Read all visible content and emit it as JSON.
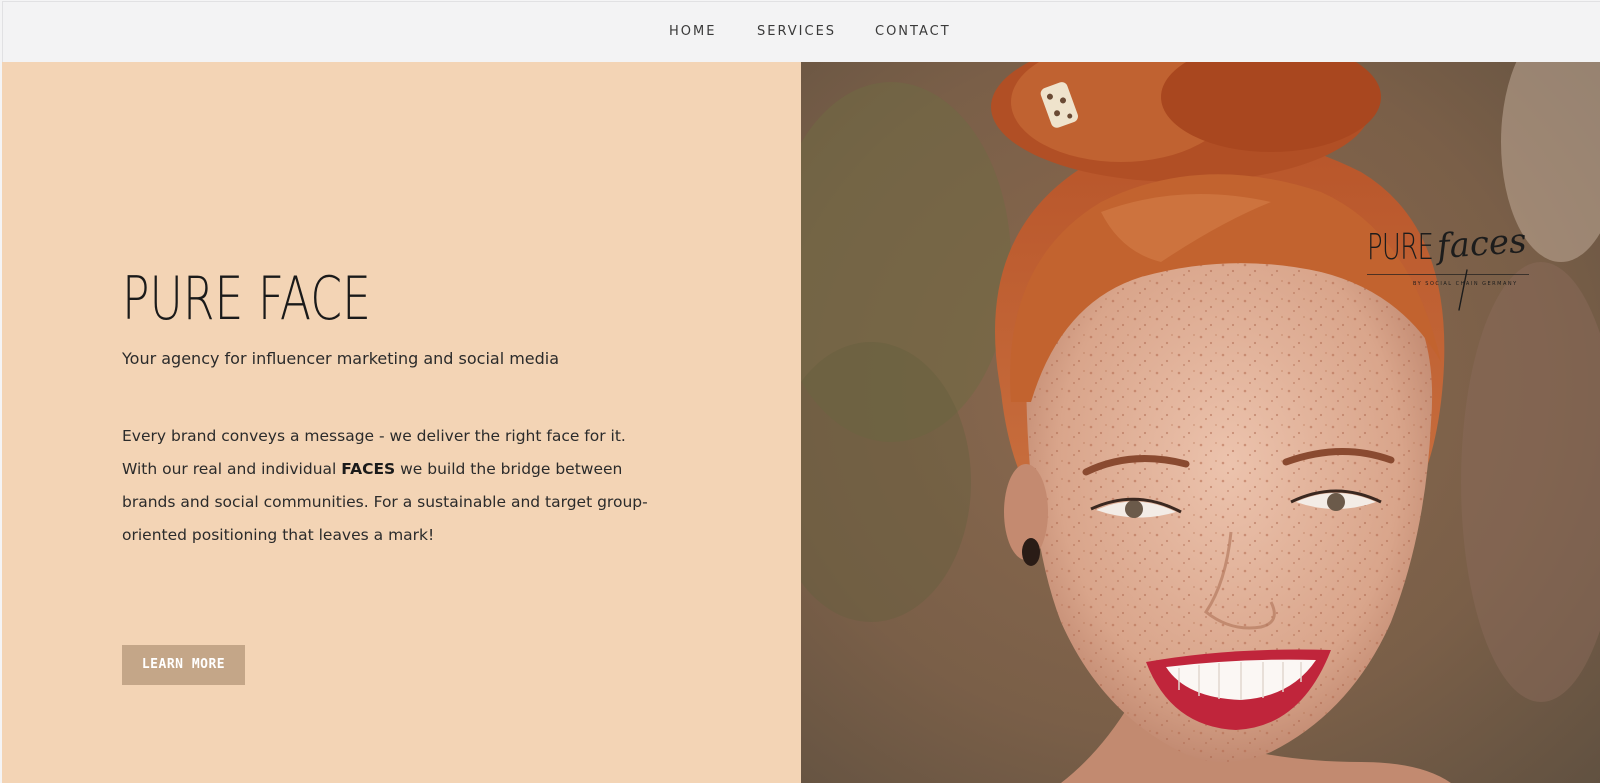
{
  "nav": {
    "items": [
      {
        "label": "HOME"
      },
      {
        "label": "SERVICES"
      },
      {
        "label": "CONTACT"
      }
    ]
  },
  "hero": {
    "title": "PURE FACE",
    "subtitle": "Your agency for influencer marketing and social media",
    "body": {
      "line1": "Every brand conveys a message - we deliver the right face for it.",
      "line2_before": "With our real and individual ",
      "line2_bold": "FACES",
      "line2_after": " we build the bridge between",
      "line3": "brands and social communities. For a sustainable and target group-",
      "line4": "oriented positioning that leaves a mark!"
    },
    "cta_label": "LEARN MORE"
  },
  "logo": {
    "word1": "PURE",
    "word2": "faces",
    "tagline": "BY SOCIAL CHAIN GERMANY"
  },
  "colors": {
    "hero_background": "#f3d4b5",
    "button_background": "#c4a688",
    "navbar_background": "#f3f3f4"
  }
}
